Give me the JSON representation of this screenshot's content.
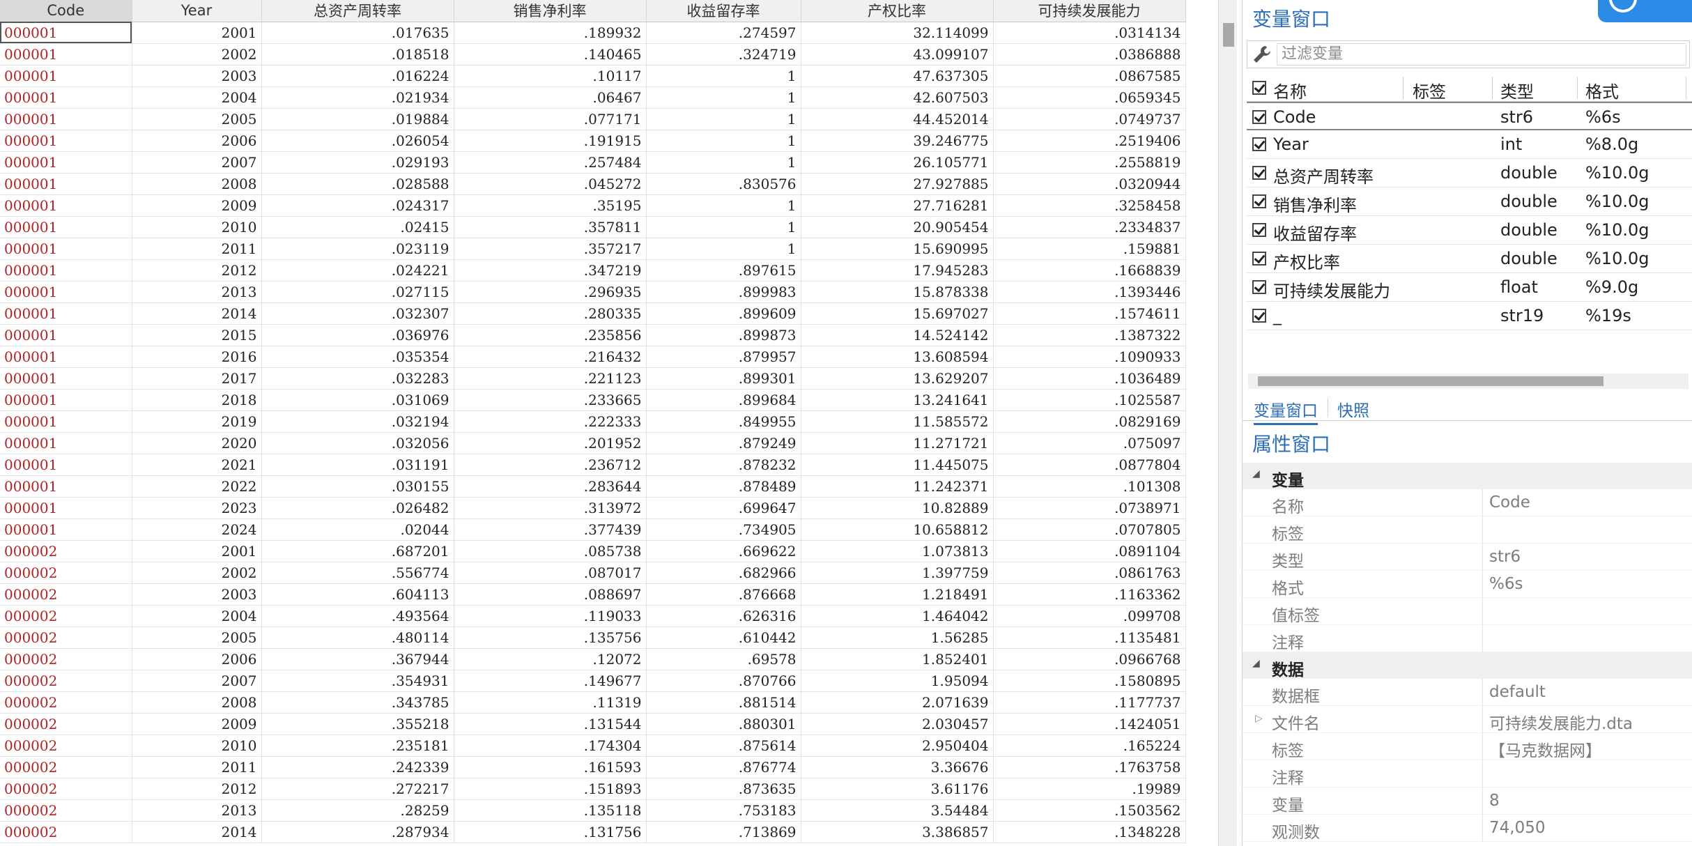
{
  "grid": {
    "columns": [
      "Code",
      "Year",
      "总资产周转率",
      "销售净利率",
      "收益留存率",
      "产权比率",
      "可持续发展能力"
    ],
    "rows": [
      [
        "000001",
        "2001",
        ".017635",
        ".189932",
        ".274597",
        "32.114099",
        ".0314134"
      ],
      [
        "000001",
        "2002",
        ".018518",
        ".140465",
        ".324719",
        "43.099107",
        ".0386888"
      ],
      [
        "000001",
        "2003",
        ".016224",
        ".10117",
        "1",
        "47.637305",
        ".0867585"
      ],
      [
        "000001",
        "2004",
        ".021934",
        ".06467",
        "1",
        "42.607503",
        ".0659345"
      ],
      [
        "000001",
        "2005",
        ".019884",
        ".077171",
        "1",
        "44.452014",
        ".0749737"
      ],
      [
        "000001",
        "2006",
        ".026054",
        ".191915",
        "1",
        "39.246775",
        ".2519406"
      ],
      [
        "000001",
        "2007",
        ".029193",
        ".257484",
        "1",
        "26.105771",
        ".2558819"
      ],
      [
        "000001",
        "2008",
        ".028588",
        ".045272",
        ".830576",
        "27.927885",
        ".0320944"
      ],
      [
        "000001",
        "2009",
        ".024317",
        ".35195",
        "1",
        "27.716281",
        ".3258458"
      ],
      [
        "000001",
        "2010",
        ".02415",
        ".357811",
        "1",
        "20.905454",
        ".2334837"
      ],
      [
        "000001",
        "2011",
        ".023119",
        ".357217",
        "1",
        "15.690995",
        ".159881"
      ],
      [
        "000001",
        "2012",
        ".024221",
        ".347219",
        ".897615",
        "17.945283",
        ".1668839"
      ],
      [
        "000001",
        "2013",
        ".027115",
        ".296935",
        ".899983",
        "15.878338",
        ".1393446"
      ],
      [
        "000001",
        "2014",
        ".032307",
        ".280335",
        ".899609",
        "15.697027",
        ".1574611"
      ],
      [
        "000001",
        "2015",
        ".036976",
        ".235856",
        ".899873",
        "14.524142",
        ".1387322"
      ],
      [
        "000001",
        "2016",
        ".035354",
        ".216432",
        ".879957",
        "13.608594",
        ".1090933"
      ],
      [
        "000001",
        "2017",
        ".032283",
        ".221123",
        ".899301",
        "13.629207",
        ".1036489"
      ],
      [
        "000001",
        "2018",
        ".031069",
        ".233665",
        ".899684",
        "13.241641",
        ".1025587"
      ],
      [
        "000001",
        "2019",
        ".032194",
        ".222333",
        ".849955",
        "11.585572",
        ".0829169"
      ],
      [
        "000001",
        "2020",
        ".032056",
        ".201952",
        ".879249",
        "11.271721",
        ".075097"
      ],
      [
        "000001",
        "2021",
        ".031191",
        ".236712",
        ".878232",
        "11.445075",
        ".0877804"
      ],
      [
        "000001",
        "2022",
        ".030155",
        ".283644",
        ".878489",
        "11.242371",
        ".101308"
      ],
      [
        "000001",
        "2023",
        ".026482",
        ".313972",
        ".699647",
        "10.82889",
        ".0738971"
      ],
      [
        "000001",
        "2024",
        ".02044",
        ".377439",
        ".734905",
        "10.658812",
        ".0707805"
      ],
      [
        "000002",
        "2001",
        ".687201",
        ".085738",
        ".669622",
        "1.073813",
        ".0891104"
      ],
      [
        "000002",
        "2002",
        ".556774",
        ".087017",
        ".682966",
        "1.397759",
        ".0861763"
      ],
      [
        "000002",
        "2003",
        ".604113",
        ".088697",
        ".876668",
        "1.218491",
        ".1163362"
      ],
      [
        "000002",
        "2004",
        ".493564",
        ".119033",
        ".626316",
        "1.464042",
        ".099708"
      ],
      [
        "000002",
        "2005",
        ".480114",
        ".135756",
        ".610442",
        "1.56285",
        ".1135481"
      ],
      [
        "000002",
        "2006",
        ".367944",
        ".12072",
        ".69578",
        "1.852401",
        ".0966768"
      ],
      [
        "000002",
        "2007",
        ".354931",
        ".149677",
        ".870766",
        "1.95094",
        ".1580895"
      ],
      [
        "000002",
        "2008",
        ".343785",
        ".11319",
        ".881514",
        "2.071639",
        ".1177737"
      ],
      [
        "000002",
        "2009",
        ".355218",
        ".131544",
        ".880301",
        "2.030457",
        ".1424051"
      ],
      [
        "000002",
        "2010",
        ".235181",
        ".174304",
        ".875614",
        "2.950404",
        ".165224"
      ],
      [
        "000002",
        "2011",
        ".242339",
        ".161593",
        ".876774",
        "3.36676",
        ".1763758"
      ],
      [
        "000002",
        "2012",
        ".272217",
        ".151893",
        ".873635",
        "3.61176",
        ".19989"
      ],
      [
        "000002",
        "2013",
        ".28259",
        ".135118",
        ".753183",
        "3.54484",
        ".1503562"
      ],
      [
        "000002",
        "2014",
        ".287934",
        ".131756",
        ".713869",
        "3.386857",
        ".1348228"
      ]
    ]
  },
  "variables_window": {
    "title": "变量窗口",
    "filter_placeholder": "过滤变量",
    "headers": {
      "name": "名称",
      "label": "标签",
      "type": "类型",
      "format": "格式"
    },
    "variables": [
      {
        "name": "Code",
        "label": "",
        "type": "str6",
        "format": "%6s"
      },
      {
        "name": "Year",
        "label": "",
        "type": "int",
        "format": "%8.0g"
      },
      {
        "name": "总资产周转率",
        "label": "",
        "type": "double",
        "format": "%10.0g"
      },
      {
        "name": "销售净利率",
        "label": "",
        "type": "double",
        "format": "%10.0g"
      },
      {
        "name": "收益留存率",
        "label": "",
        "type": "double",
        "format": "%10.0g"
      },
      {
        "name": "产权比率",
        "label": "",
        "type": "double",
        "format": "%10.0g"
      },
      {
        "name": "可持续发展能力",
        "label": "",
        "type": "float",
        "format": "%9.0g"
      },
      {
        "name": "_",
        "label": "",
        "type": "str19",
        "format": "%19s"
      }
    ]
  },
  "tabs": {
    "variables": "变量窗口",
    "snapshots": "快照"
  },
  "properties_window": {
    "title": "属性窗口",
    "sections": [
      {
        "title": "变量",
        "rows": [
          {
            "key": "名称",
            "value": "Code"
          },
          {
            "key": "标签",
            "value": ""
          },
          {
            "key": "类型",
            "value": "str6"
          },
          {
            "key": "格式",
            "value": "%6s"
          },
          {
            "key": "值标签",
            "value": ""
          },
          {
            "key": "注释",
            "value": ""
          }
        ]
      },
      {
        "title": "数据",
        "rows": [
          {
            "key": "数据框",
            "value": "default"
          },
          {
            "key": "文件名",
            "value": "可持续发展能力.dta",
            "expandable": true
          },
          {
            "key": "标签",
            "value": "【马克数据网】"
          },
          {
            "key": "注释",
            "value": ""
          },
          {
            "key": "变量",
            "value": "8"
          },
          {
            "key": "观测数",
            "value": "74,050"
          }
        ]
      }
    ]
  },
  "colors": {
    "accent": "#2a6eb8",
    "code_text": "#b22222",
    "badge": "#2b8be6"
  }
}
